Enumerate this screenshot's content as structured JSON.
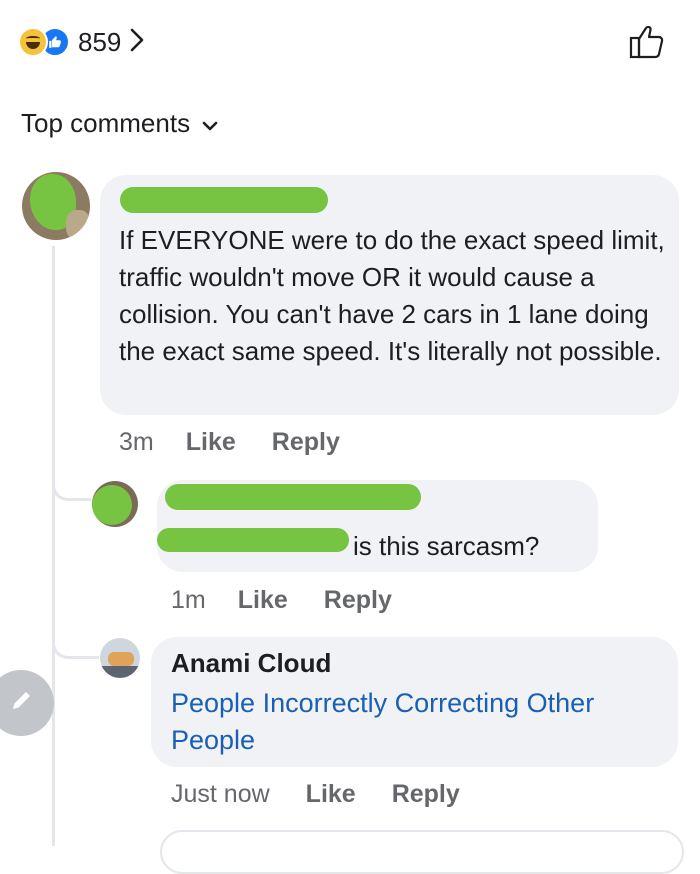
{
  "reactions": {
    "count": "859",
    "icons": [
      "haha-emoji-icon",
      "like-reaction-icon"
    ],
    "chevron_icon": "chevron-right-icon"
  },
  "like_button_icon": "thumbs-up-outline-icon",
  "filter": {
    "label": "Top comments",
    "icon": "chevron-down-icon"
  },
  "comments": [
    {
      "text": "If EVERYONE were to do the exact speed limit, traffic wouldn't move OR it would cause a collision. You can't have 2 cars in 1 lane doing the exact same speed. It's literally not possible.",
      "time": "3m",
      "like": "Like",
      "reply": "Reply"
    },
    {
      "text": "is this sarcasm?",
      "time": "1m",
      "like": "Like",
      "reply": "Reply"
    },
    {
      "author": "Anami Cloud",
      "text": "People Incorrectly Correcting Other People",
      "time": "Just now",
      "like": "Like",
      "reply": "Reply"
    }
  ],
  "fab_icon": "pencil-icon",
  "colors": {
    "bubble": "#f0f2f5",
    "link": "#1a5fb4",
    "meta": "#65676b",
    "redaction": "#76c442",
    "like_blue": "#1877f2"
  }
}
